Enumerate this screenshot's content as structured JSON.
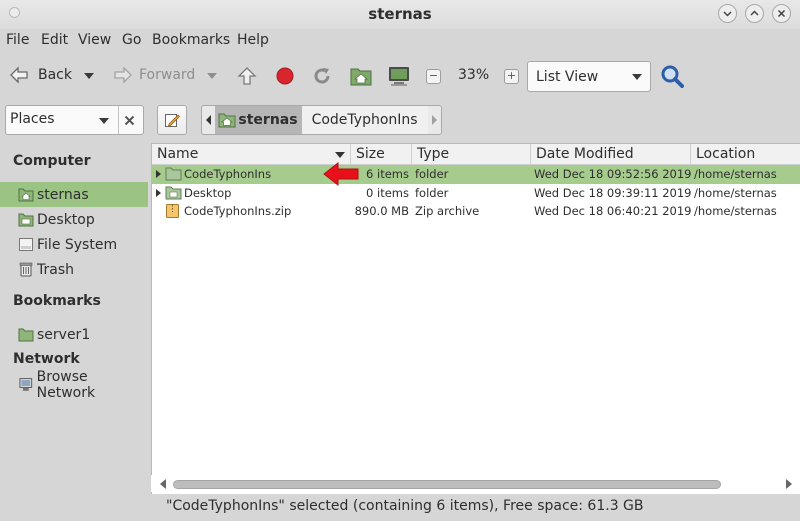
{
  "window": {
    "title": "sternas"
  },
  "menu": [
    "File",
    "Edit",
    "View",
    "Go",
    "Bookmarks",
    "Help"
  ],
  "toolbar": {
    "back_label": "Back",
    "forward_label": "Forward",
    "zoom": "33%",
    "view_mode": "List View"
  },
  "location": {
    "places_label": "Places",
    "breadcrumbs": [
      "sternas",
      "CodeTyphonIns"
    ]
  },
  "sidebar": {
    "computer_header": "Computer",
    "computer_items": [
      "sternas",
      "Desktop",
      "File System",
      "Trash"
    ],
    "bookmarks_header": "Bookmarks",
    "bookmark_items": [
      "server1"
    ],
    "network_header": "Network",
    "network_items": [
      "Browse Network"
    ]
  },
  "columns": [
    "Name",
    "Size",
    "Type",
    "Date Modified",
    "Location"
  ],
  "files": [
    {
      "name": "CodeTyphonIns",
      "size": "6 items",
      "type": "folder",
      "modified": "Wed Dec 18 09:52:56 2019",
      "location": "/home/sternas"
    },
    {
      "name": "Desktop",
      "size": "0 items",
      "type": "folder",
      "modified": "Wed Dec 18 09:39:11 2019",
      "location": "/home/sternas"
    },
    {
      "name": "CodeTyphonIns.zip",
      "size": "890.0 MB",
      "type": "Zip archive",
      "modified": "Wed Dec 18 06:40:21 2019",
      "location": "/home/sternas"
    }
  ],
  "status": "\"CodeTyphonIns\" selected (containing 6 items), Free space: 61.3 GB",
  "colors": {
    "selection": "#a6cc8d",
    "sidebar_selection": "#9bc384",
    "annotation_arrow": "#e8101a"
  }
}
